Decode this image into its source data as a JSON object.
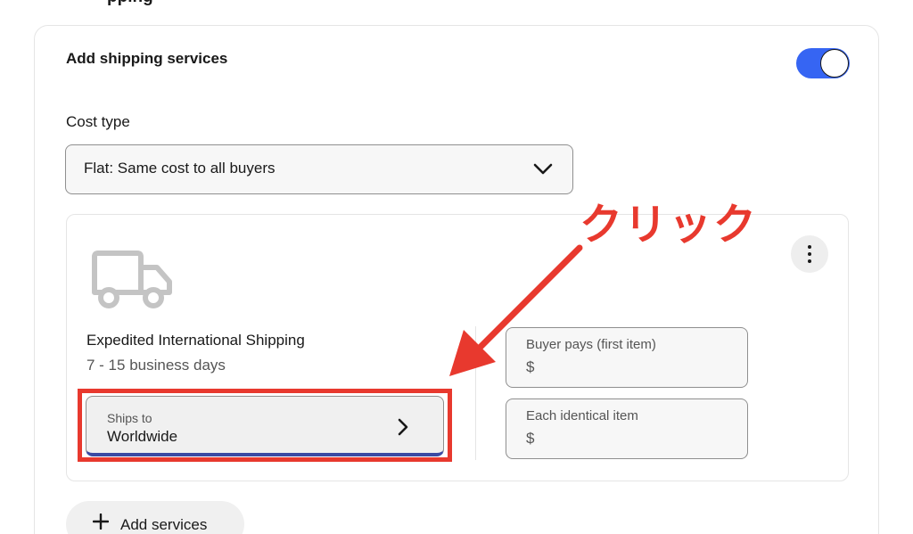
{
  "header": {
    "partial_title": "pping"
  },
  "shipping_services": {
    "title": "Add shipping services",
    "toggle_on": true,
    "accent_color": "#3665f3"
  },
  "cost_type": {
    "label": "Cost type",
    "selected": "Flat: Same cost to all buyers"
  },
  "service": {
    "icon": "truck-icon",
    "name": "Expedited International Shipping",
    "delivery_time": "7 - 15 business days",
    "ships_to_label": "Ships to",
    "ships_to_value": "Worldwide",
    "buyer_pays_label": "Buyer pays (first item)",
    "buyer_pays_prefix": "$",
    "each_item_label": "Each identical item",
    "each_item_prefix": "$"
  },
  "annotation": {
    "text": "クリック",
    "color": "#e8392e"
  },
  "actions": {
    "add_services_label": "Add services"
  }
}
